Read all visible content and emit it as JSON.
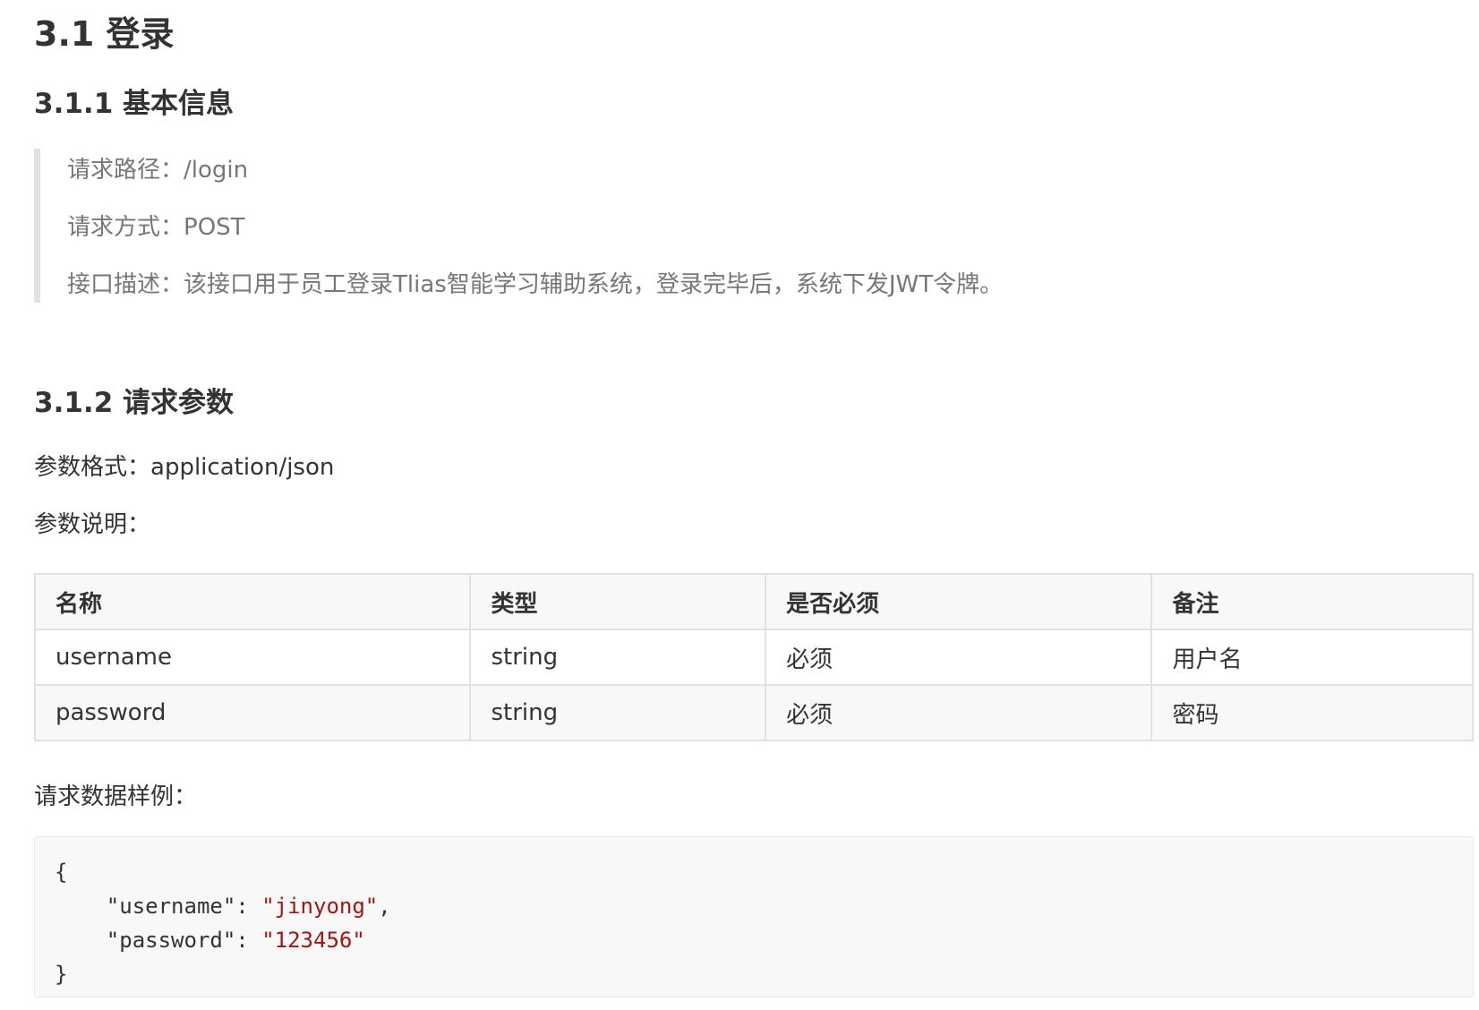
{
  "section": {
    "title": "3.1 登录"
  },
  "basic": {
    "heading": "3.1.1 基本信息",
    "path_label": "请求路径：",
    "path_value": "/login",
    "method_label": "请求方式：",
    "method_value": "POST",
    "desc_label": "接口描述：",
    "desc_value": "该接口用于员工登录Tlias智能学习辅助系统，登录完毕后，系统下发JWT令牌。"
  },
  "params": {
    "heading": "3.1.2 请求参数",
    "format_label": "参数格式：",
    "format_value": "application/json",
    "desc_label": "参数说明：",
    "table": {
      "headers": [
        "名称",
        "类型",
        "是否必须",
        "备注"
      ],
      "rows": [
        [
          "username",
          "string",
          "必须",
          "用户名"
        ],
        [
          "password",
          "string",
          "必须",
          "密码"
        ]
      ]
    },
    "sample_label": "请求数据样例："
  },
  "code": {
    "open_brace": "{",
    "close_brace": "}",
    "fields": [
      {
        "key": "\"username\"",
        "sep": ": ",
        "value": "\"jinyong\"",
        "trail": ","
      },
      {
        "key": "\"password\"",
        "sep": ": ",
        "value": "\"123456\"",
        "trail": ""
      }
    ],
    "colors": {
      "string": "#a31515",
      "text": "#333333"
    }
  }
}
